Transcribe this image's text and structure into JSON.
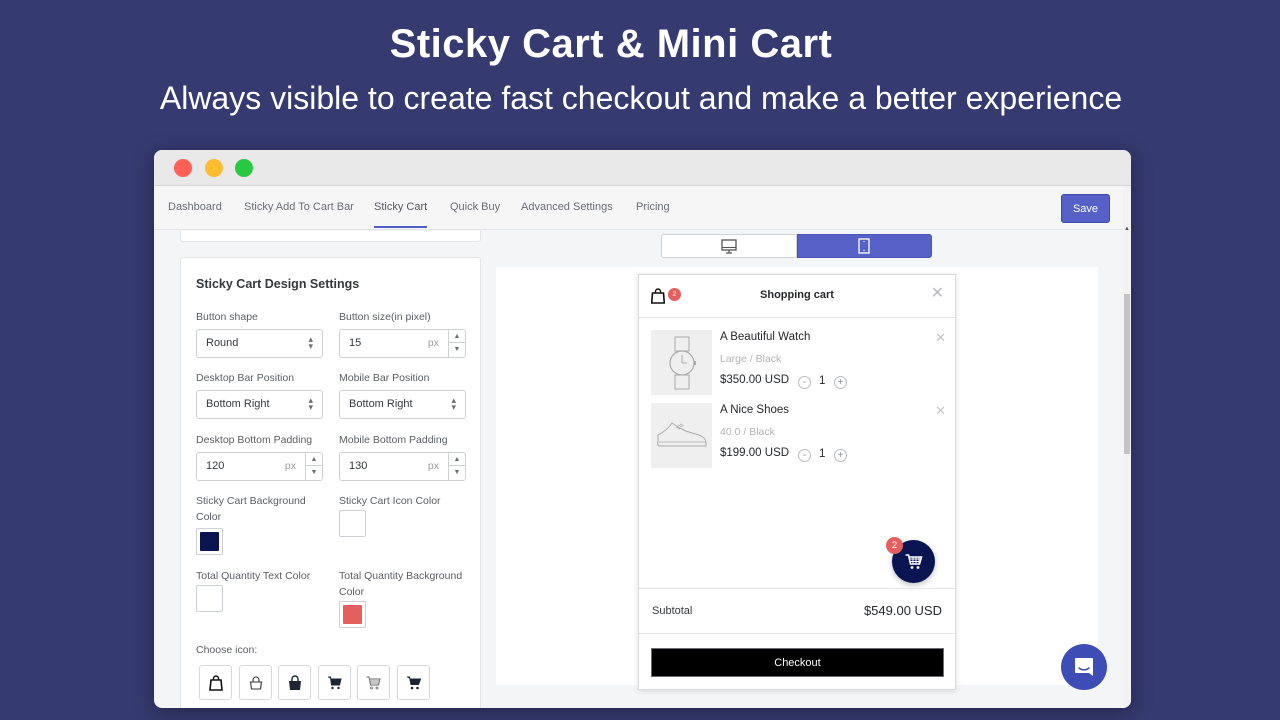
{
  "hero": {
    "title": "Sticky Cart & Mini Cart",
    "subtitle": "Always visible to create fast checkout and make a better experience"
  },
  "nav": {
    "tabs": [
      {
        "label": "Dashboard",
        "active": false
      },
      {
        "label": "Sticky Add To Cart Bar",
        "active": false
      },
      {
        "label": "Sticky Cart",
        "active": true
      },
      {
        "label": "Quick Buy",
        "active": false
      },
      {
        "label": "Advanced Settings",
        "active": false
      },
      {
        "label": "Pricing",
        "active": false
      }
    ],
    "save_label": "Save"
  },
  "settings": {
    "title": "Sticky Cart Design Settings",
    "button_shape": {
      "label": "Button shape",
      "value": "Round"
    },
    "button_size": {
      "label": "Button size(in pixel)",
      "value": "15",
      "unit": "px"
    },
    "desktop_bar_position": {
      "label": "Desktop Bar Position",
      "value": "Bottom Right"
    },
    "mobile_bar_position": {
      "label": "Mobile Bar Position",
      "value": "Bottom Right"
    },
    "desktop_bottom_padding": {
      "label": "Desktop Bottom Padding",
      "value": "120",
      "unit": "px"
    },
    "mobile_bottom_padding": {
      "label": "Mobile Bottom Padding",
      "value": "130",
      "unit": "px"
    },
    "background_color": {
      "label_line1": "Sticky Cart Background",
      "label_line2": "Color",
      "color": "#0a1450"
    },
    "icon_color": {
      "label": "Sticky Cart Icon Color",
      "color": "#ffffff"
    },
    "qty_text_color": {
      "label": "Total Quantity Text Color",
      "color": "#ffffff"
    },
    "qty_bg_color": {
      "label_line1": "Total Quantity Background",
      "label_line2": "Color",
      "color": "#e65f5f"
    },
    "choose_icon_label": "Choose icon:",
    "icons": [
      "bag-outline-icon",
      "bag-light-icon",
      "bag-filled-icon",
      "cart-filled-icon",
      "cart-outline-icon",
      "cart-solid-icon"
    ]
  },
  "device_toggle": {
    "options": [
      "desktop-icon",
      "mobile-icon"
    ],
    "selected": "mobile"
  },
  "mini_cart": {
    "title": "Shopping cart",
    "badge_count": "2",
    "items": [
      {
        "name": "A Beautiful Watch",
        "variant": "Large / Black",
        "price": "$350.00 USD",
        "qty": "1",
        "image": "watch"
      },
      {
        "name": "A Nice Shoes",
        "variant": "40.0 / Black",
        "price": "$199.00 USD",
        "qty": "1",
        "image": "shoe"
      }
    ],
    "subtotal_label": "Subtotal",
    "subtotal_value": "$549.00 USD",
    "checkout_label": "Checkout",
    "fab_badge": "2"
  },
  "colors": {
    "background": "#353a70",
    "accent": "#5661c7",
    "sticky_cart_bg": "#0a1450",
    "badge": "#e65f5f"
  }
}
